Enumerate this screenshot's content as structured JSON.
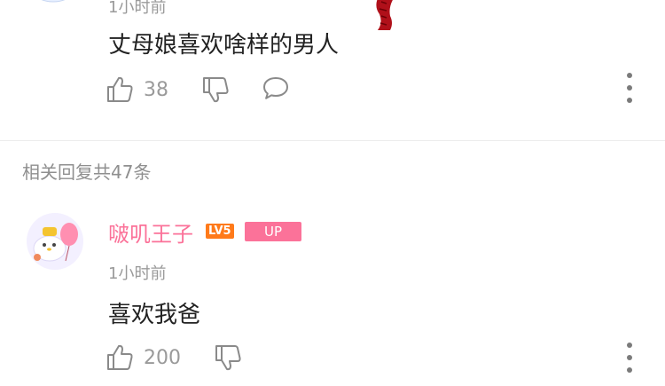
{
  "comment_main": {
    "time": "1小时前",
    "text": "丈母娘喜欢啥样的男人",
    "like_count": "38"
  },
  "replies_header": "相关回复共47条",
  "reply": {
    "username": "啵叽王子",
    "level_badge": "LV5",
    "up_badge": "UP",
    "time": "1小时前",
    "text": "喜欢我爸",
    "like_count": "200"
  },
  "colors": {
    "username_pink": "#fb7299",
    "level_orange": "#ff7a1a",
    "icon_gray": "#8a8a8a"
  }
}
